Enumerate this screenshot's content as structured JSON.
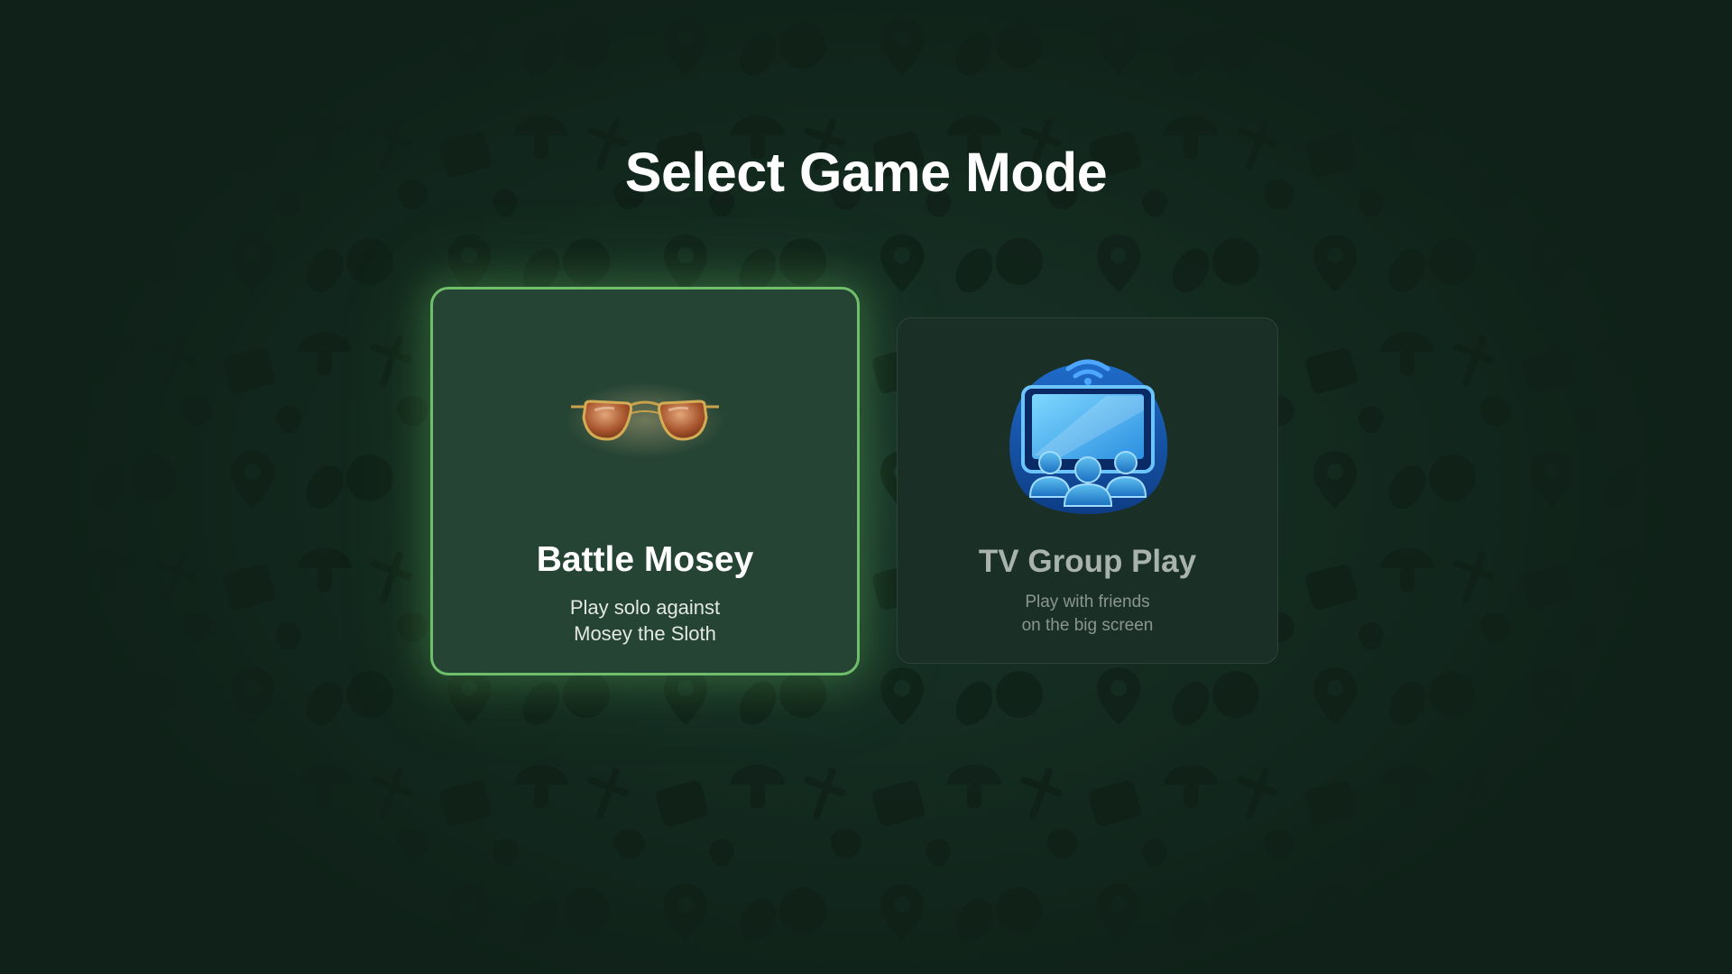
{
  "page": {
    "title": "Select Game Mode"
  },
  "modes": [
    {
      "title": "Battle Mosey",
      "subtitle_lines": [
        "Play solo against",
        "Mosey the Sloth"
      ],
      "icon": "aviator-sunglasses-icon",
      "selected": true
    },
    {
      "title": "TV Group Play",
      "subtitle_lines": [
        "Play with friends",
        "on the big screen"
      ],
      "icon": "tv-group-icon",
      "selected": false
    }
  ],
  "colors": {
    "background": "#11231a",
    "selected_border": "#6fbe6c",
    "selected_card": "#264434",
    "dim_card": "#1a3026"
  }
}
